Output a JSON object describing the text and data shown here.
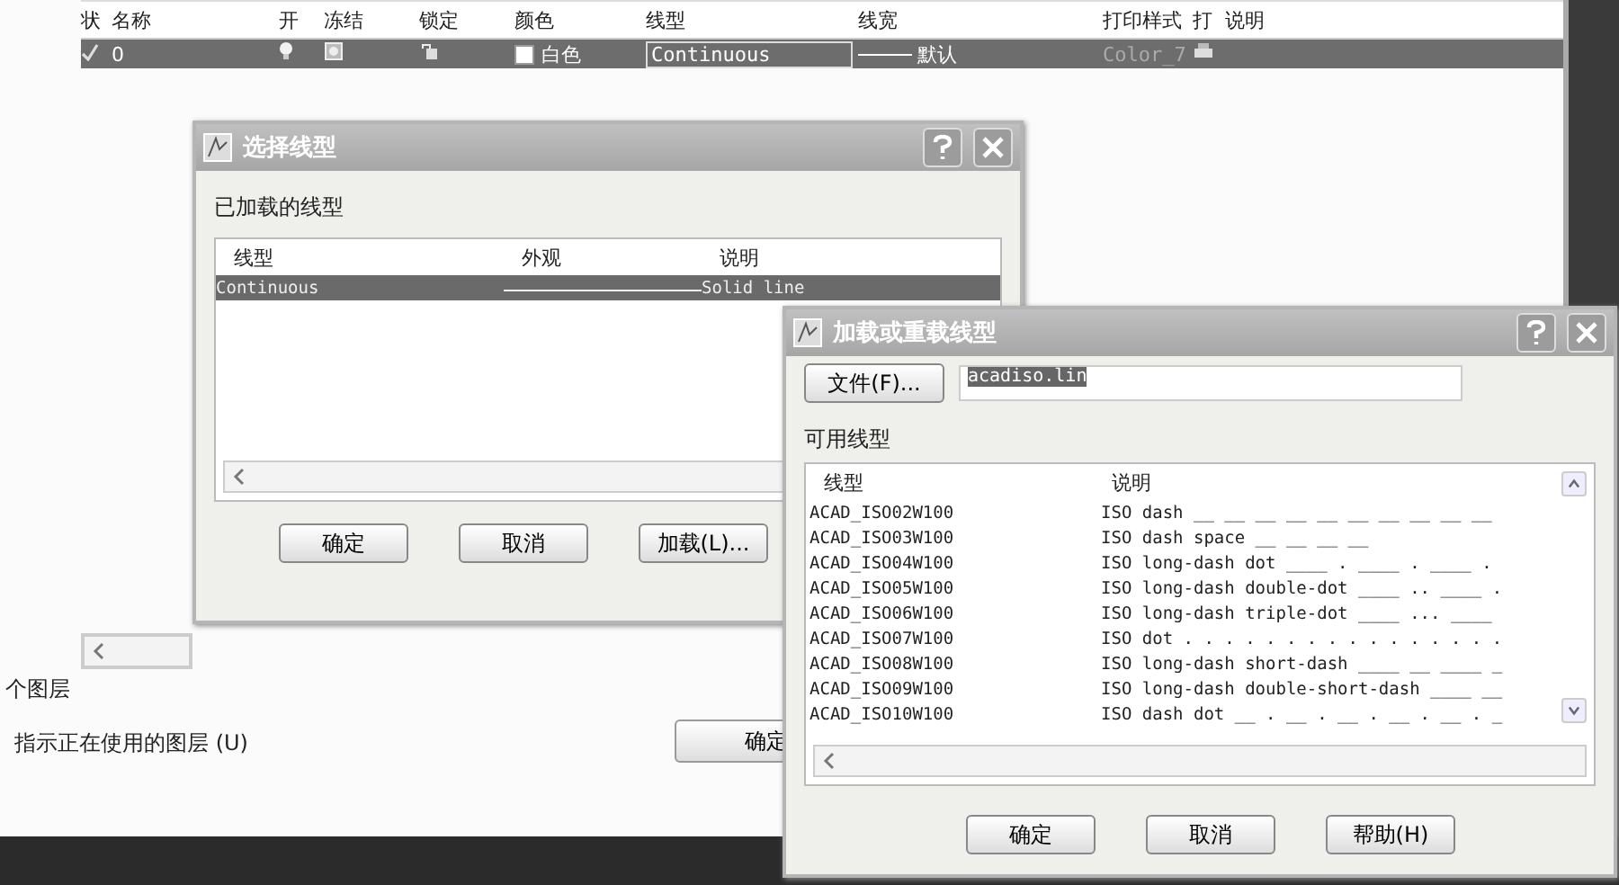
{
  "layer_table": {
    "columns": [
      "状",
      "名称",
      "开",
      "冻结",
      "锁定",
      "颜色",
      "线型",
      "线宽",
      "打印样式",
      "打",
      "说明"
    ],
    "rows": [
      {
        "name": "0",
        "color_name": "白色",
        "linetype": "Continuous",
        "lineweight": "默认",
        "plot_style": "Color_7",
        "selected": true
      }
    ]
  },
  "layer_footer": {
    "count_text": "个图层",
    "option_text": "指示正在使用的图层 (U)",
    "ok_button": "确定"
  },
  "select_dialog": {
    "title": "选择线型",
    "section": "已加载的线型",
    "columns": [
      "线型",
      "外观",
      "说明"
    ],
    "rows": [
      {
        "name": "Continuous",
        "description": "Solid line",
        "selected": true
      }
    ],
    "buttons": [
      "确定",
      "取消",
      "加载(L)..."
    ]
  },
  "load_dialog": {
    "title": "加载或重载线型",
    "file_button": "文件(F)...",
    "file_value": "acadiso.lin",
    "section": "可用线型",
    "columns": [
      "线型",
      "说明"
    ],
    "rows": [
      {
        "name": "ACAD_ISO02W100",
        "description": "ISO dash __ __ __ __ __ __ __ __ __ __"
      },
      {
        "name": "ACAD_ISO03W100",
        "description": "ISO dash space __    __    __    __"
      },
      {
        "name": "ACAD_ISO04W100",
        "description": "ISO long-dash dot ____ . ____ . ____ ."
      },
      {
        "name": "ACAD_ISO05W100",
        "description": "ISO long-dash double-dot ____ .. ____ ."
      },
      {
        "name": "ACAD_ISO06W100",
        "description": "ISO long-dash triple-dot ____ ... ____"
      },
      {
        "name": "ACAD_ISO07W100",
        "description": "ISO dot . . . . . . . . . . . . . . . ."
      },
      {
        "name": "ACAD_ISO08W100",
        "description": "ISO long-dash short-dash ____ __ ____ _"
      },
      {
        "name": "ACAD_ISO09W100",
        "description": "ISO long-dash double-short-dash ____ __"
      },
      {
        "name": "ACAD_ISO10W100",
        "description": "ISO dash dot __ . __ . __ . __ . __ . _"
      }
    ],
    "buttons": [
      "确定",
      "取消",
      "帮助(H)"
    ]
  }
}
